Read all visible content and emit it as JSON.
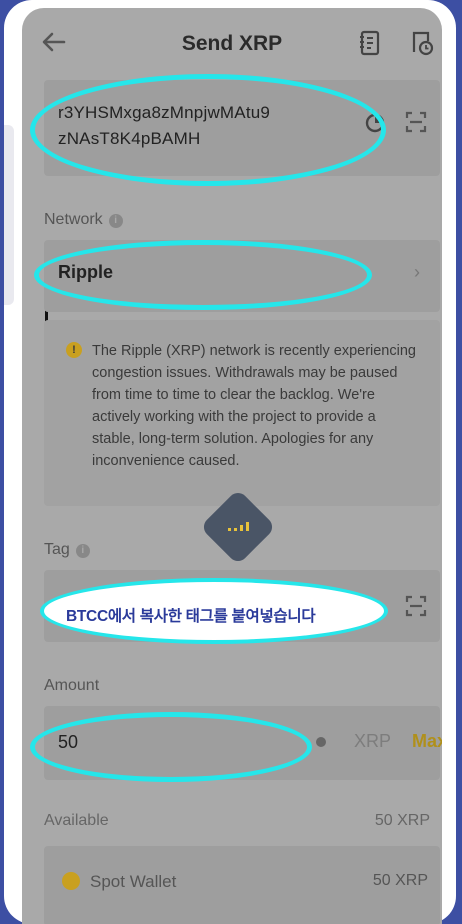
{
  "header": {
    "title": "Send XRP"
  },
  "address": {
    "value_line1": "r3YHSMxga8zMnpjwMAtu9",
    "value_line2": "zNAsT8K4pBAMH"
  },
  "network": {
    "label": "Network",
    "value": "Ripple"
  },
  "notice": {
    "text": "The Ripple (XRP) network is recently experiencing congestion issues. Withdrawals may be paused from time to time to clear the backlog. We're actively working with the project to provide a stable, long-term solution. Apologies for any inconvenience caused."
  },
  "tag": {
    "label": "Tag",
    "overlay_text": "BTCC에서 복사한 태그를 붙여넣습니다"
  },
  "amount": {
    "label": "Amount",
    "value": "50",
    "unit": "XRP",
    "max_label": "Max"
  },
  "available": {
    "label": "Available",
    "value": "50 XRP"
  },
  "wallet": {
    "label": "Spot Wallet",
    "value": "50 XRP"
  },
  "colors": {
    "highlight": "#25e6ea",
    "accent_gold": "#b0901b",
    "background": "#3d4fa3"
  },
  "icons": [
    "back-arrow-icon",
    "address-book-icon",
    "history-icon",
    "paste-icon",
    "scan-icon",
    "info-icon",
    "chevron-right-icon",
    "warning-icon",
    "loading-icon",
    "wallet-icon"
  ]
}
